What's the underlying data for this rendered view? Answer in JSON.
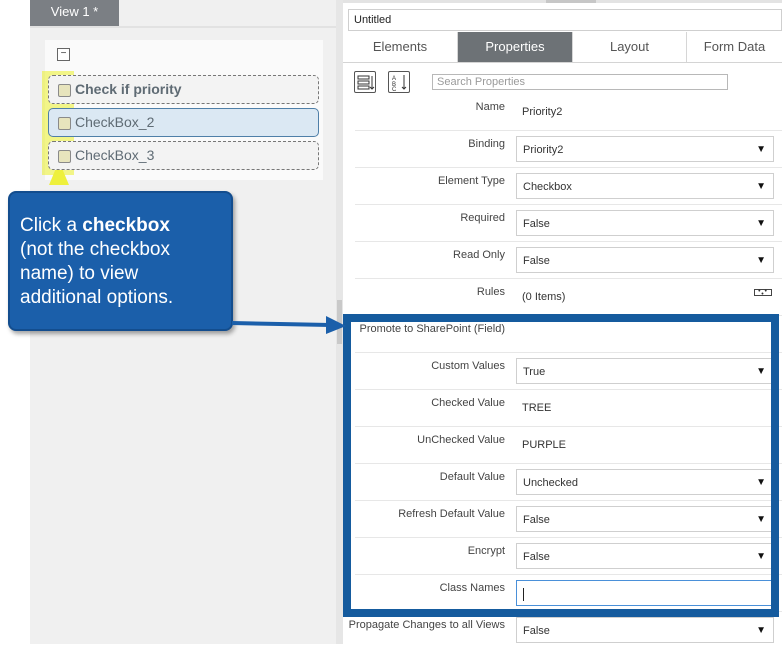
{
  "view_tab": "View 1 *",
  "form_items": [
    {
      "label": "Check if priority",
      "bold": true
    },
    {
      "label": "CheckBox_2",
      "bold": false
    },
    {
      "label": "CheckBox_3",
      "bold": false
    }
  ],
  "callout": {
    "line1_pre": "Click a ",
    "line1_bold": "checkbox",
    "rest": "(not the checkbox name) to view additional options."
  },
  "title_field": "Untitled",
  "tabs": [
    "Elements",
    "Properties",
    "Layout",
    "Form Data"
  ],
  "active_tab": "Properties",
  "search_placeholder": "Search Properties",
  "properties": [
    {
      "label": "Name",
      "value": "Priority2",
      "type": "text"
    },
    {
      "label": "Binding",
      "value": "Priority2",
      "type": "select"
    },
    {
      "label": "Element Type",
      "value": "Checkbox",
      "type": "select"
    },
    {
      "label": "Required",
      "value": "False",
      "type": "select"
    },
    {
      "label": "Read Only",
      "value": "False",
      "type": "select"
    },
    {
      "label": "Rules",
      "value": "(0 Items)",
      "type": "rules"
    },
    {
      "label": "Promote to SharePoint (Field)",
      "value": "",
      "type": "text"
    },
    {
      "label": "Custom Values",
      "value": "True",
      "type": "select"
    },
    {
      "label": "Checked Value",
      "value": "TREE",
      "type": "text"
    },
    {
      "label": "UnChecked Value",
      "value": "PURPLE",
      "type": "text"
    },
    {
      "label": "Default Value",
      "value": "Unchecked",
      "type": "select"
    },
    {
      "label": "Refresh Default Value",
      "value": "False",
      "type": "select"
    },
    {
      "label": "Encrypt",
      "value": "False",
      "type": "select"
    },
    {
      "label": "Class Names",
      "value": "",
      "type": "focus"
    },
    {
      "label": "Propagate Changes to all Views",
      "value": "False",
      "type": "select"
    }
  ],
  "colors": {
    "callout": "#1b5faa",
    "frame": "#155b9e",
    "highlight": "#eef03c",
    "active_tab": "#6d7276"
  }
}
